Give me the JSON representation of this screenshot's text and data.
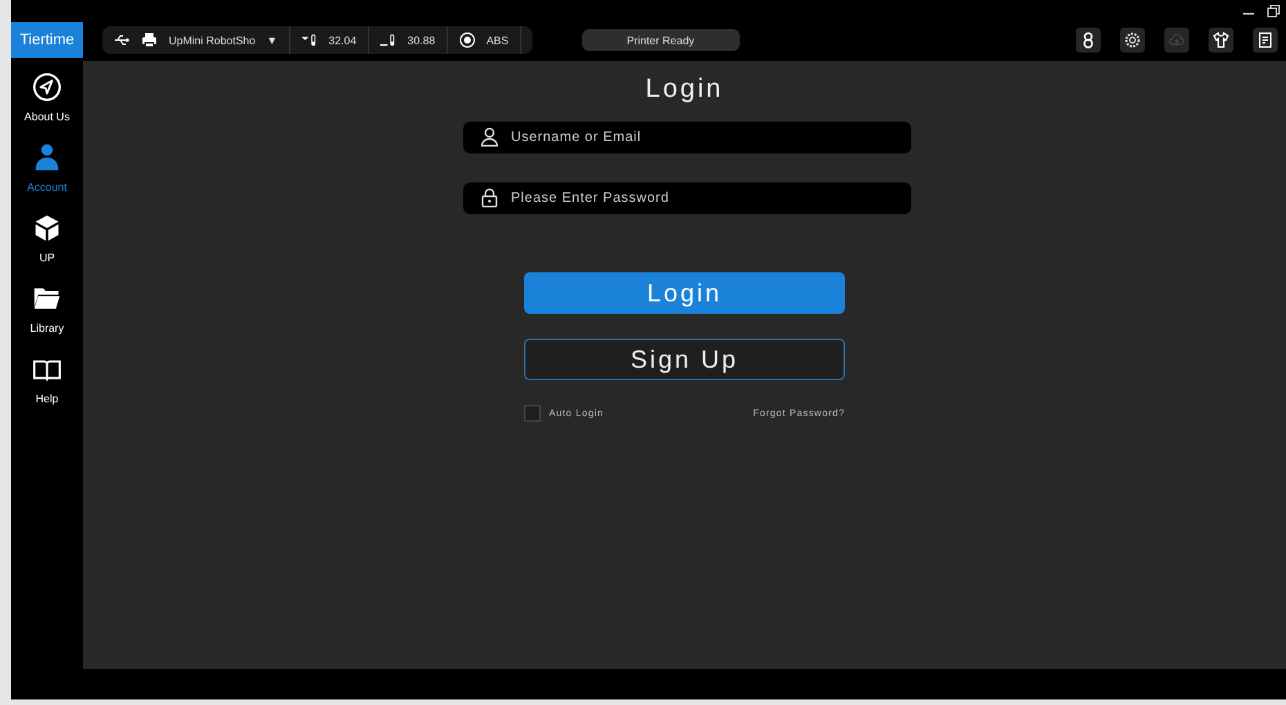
{
  "toolbar": {
    "logo": "Tiertime",
    "printer_name": "UpMini RobotSho",
    "dropdown": "▼",
    "nozzle_temp": "32.04",
    "bed_temp": "30.88",
    "material": "ABS",
    "status": "Printer Ready"
  },
  "sidebar": {
    "items": [
      {
        "label": "About Us",
        "selected": false
      },
      {
        "label": "Account",
        "selected": true
      },
      {
        "label": "UP",
        "selected": false
      },
      {
        "label": "Library",
        "selected": false
      },
      {
        "label": "Help",
        "selected": false
      }
    ]
  },
  "login": {
    "title": "Login",
    "username": {
      "placeholder": "Username or Email"
    },
    "password": {
      "placeholder": "Please Enter Password"
    },
    "login_button": "Login",
    "signup_button": "Sign Up",
    "auto_login": {
      "label": "Auto Login",
      "checked": false
    },
    "forgot_link": "Forgot Password?"
  }
}
